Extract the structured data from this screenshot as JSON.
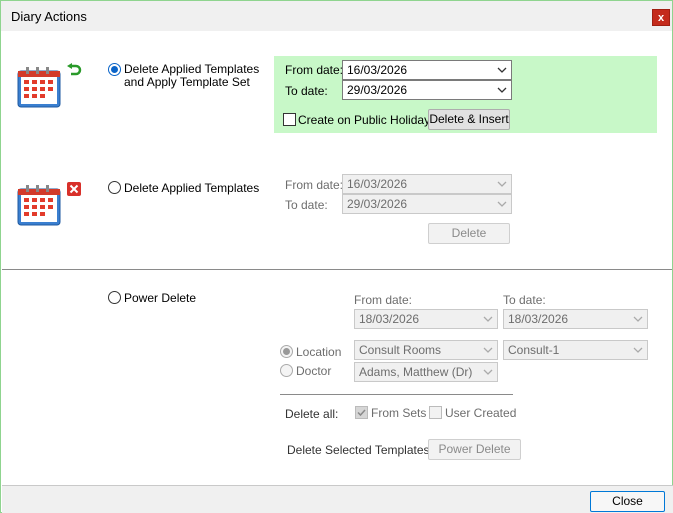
{
  "window": {
    "title": "Diary Actions",
    "close_glyph": "x"
  },
  "section1": {
    "radio_line1": "Delete Applied Templates",
    "radio_line2": "and Apply Template Set",
    "from_label": "From date:",
    "from_value": "16/03/2026",
    "to_label": "To date:",
    "to_value": "29/03/2026",
    "holidays_label": "Create on Public Holidays",
    "button_label": "Delete & Insert",
    "highlight_color": "#c8f8c8"
  },
  "section2": {
    "radio_label": "Delete Applied Templates",
    "from_label": "From date:",
    "from_value": "16/03/2026",
    "to_label": "To date:",
    "to_value": "29/03/2026",
    "button_label": "Delete"
  },
  "section3": {
    "radio_label": "Power Delete",
    "from_label": "From date:",
    "from_value": "18/03/2026",
    "to_label": "To date:",
    "to_value": "18/03/2026",
    "location_label": "Location",
    "doctor_label": "Doctor",
    "location_value": "Consult Rooms",
    "room_value": "Consult-1",
    "doctor_value": "Adams, Matthew (Dr)",
    "delete_all_label": "Delete all:",
    "from_sets_label": "From Sets",
    "user_created_label": "User Created",
    "selected_label": "Delete Selected Templates",
    "button_label": "Power Delete"
  },
  "footer": {
    "close_label": "Close"
  }
}
